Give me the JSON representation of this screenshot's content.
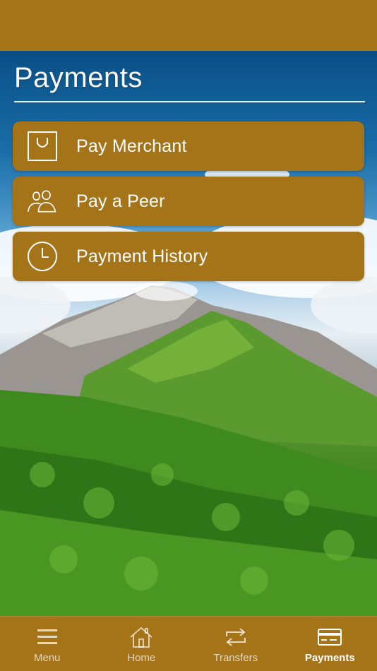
{
  "header": {
    "title": "Payments"
  },
  "menu": {
    "items": [
      {
        "label": "Pay Merchant",
        "icon": "shopping-bag-icon"
      },
      {
        "label": "Pay a Peer",
        "icon": "people-icon"
      },
      {
        "label": "Payment History",
        "icon": "clock-icon"
      }
    ]
  },
  "tabbar": {
    "tabs": [
      {
        "label": "Menu",
        "icon": "hamburger-icon",
        "active": false
      },
      {
        "label": "Home",
        "icon": "home-icon",
        "active": false
      },
      {
        "label": "Transfers",
        "icon": "transfer-arrows-icon",
        "active": false
      },
      {
        "label": "Payments",
        "icon": "credit-card-icon",
        "active": true
      }
    ]
  },
  "colors": {
    "brand": "#a57318",
    "text": "#ffffff",
    "sky": "#0a4f86"
  }
}
